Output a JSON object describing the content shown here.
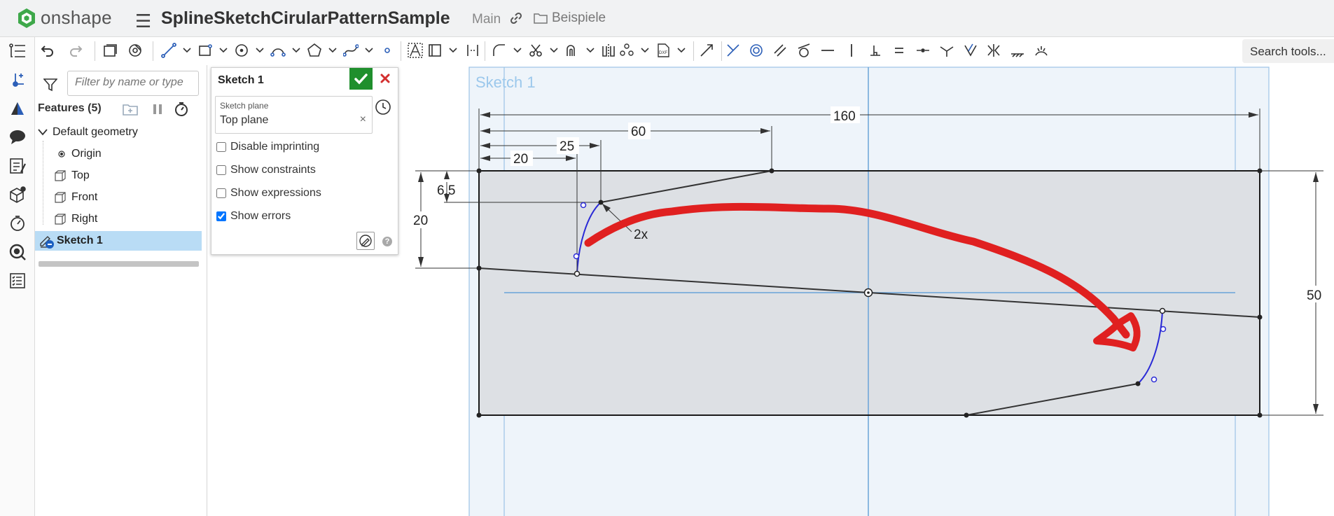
{
  "app": {
    "logo_text": "onshape",
    "doc_title": "SplineSketchCirularPatternSample",
    "branch": "Main",
    "folder": "Beispiele"
  },
  "toolbar": {
    "search_label": "Search tools...",
    "search_suffix": "a"
  },
  "features": {
    "filter_placeholder": "Filter by name or type",
    "header": "Features (5)",
    "items": [
      {
        "label": "Default geometry"
      },
      {
        "label": "Origin"
      },
      {
        "label": "Top"
      },
      {
        "label": "Front"
      },
      {
        "label": "Right"
      },
      {
        "label": "Sketch 1"
      }
    ]
  },
  "dialog": {
    "title": "Sketch 1",
    "plane_label": "Sketch plane",
    "plane_value": "Top plane",
    "clear": "×",
    "options": [
      {
        "label": "Disable imprinting",
        "checked": false
      },
      {
        "label": "Show constraints",
        "checked": false
      },
      {
        "label": "Show expressions",
        "checked": false
      },
      {
        "label": "Show errors",
        "checked": true
      }
    ],
    "help": "?"
  },
  "sketch": {
    "label": "Sketch 1",
    "dims": {
      "d160": "160",
      "d60": "60",
      "d25": "25",
      "d20h": "20",
      "d65": "6.5",
      "d20v": "20",
      "d50": "50",
      "pattern": "2x"
    }
  },
  "colors": {
    "accent_green": "#1f8f2d",
    "cancel_red": "#d32f2f",
    "spline_blue": "#2a2ad6",
    "annotation_red": "#e02020",
    "sketch_plane_blue": "#7fb3e0",
    "selection_blue": "#b9dcf5"
  }
}
